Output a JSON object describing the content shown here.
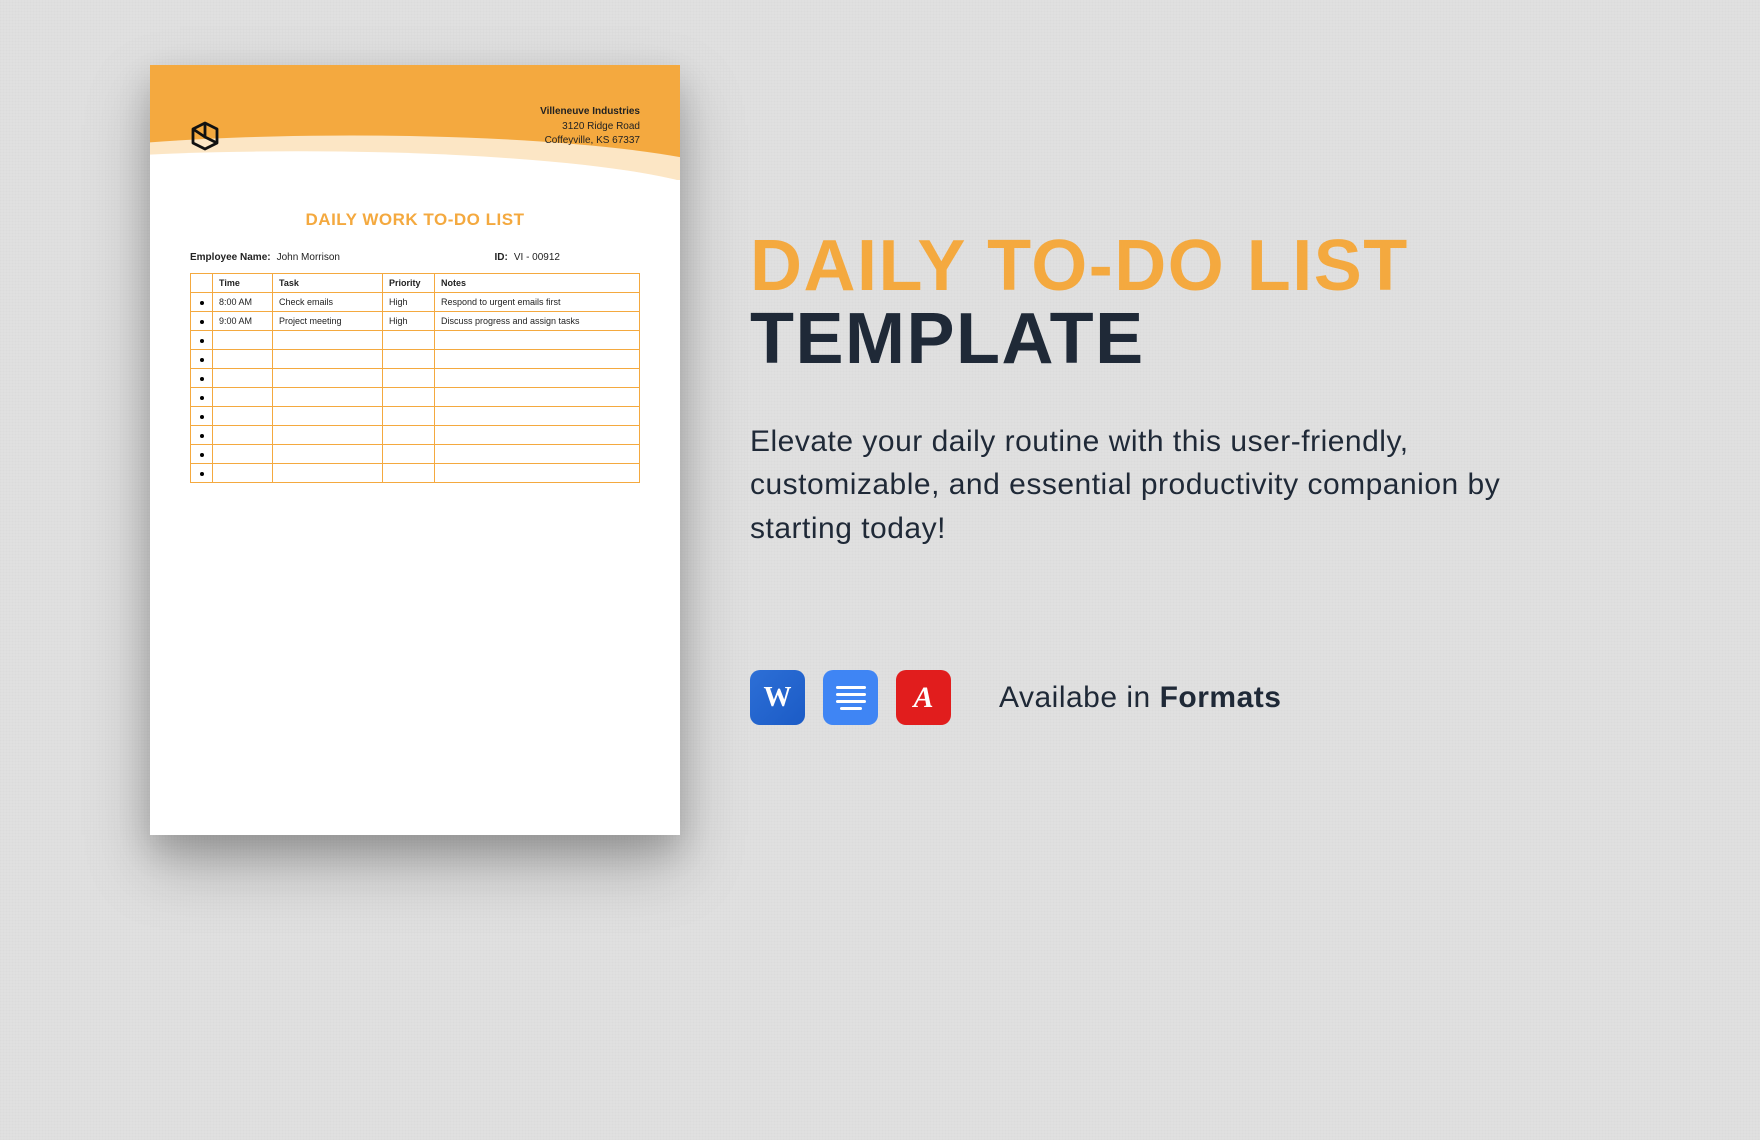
{
  "document": {
    "company": {
      "name": "Villeneuve Industries",
      "addr1": "3120 Ridge Road",
      "addr2": "Coffeyville, KS 67337"
    },
    "title": "DAILY WORK TO-DO LIST",
    "employee": {
      "label": "Employee Name:",
      "value": "John Morrison"
    },
    "id": {
      "label": "ID:",
      "value": "VI - 00912"
    },
    "columns": {
      "time": "Time",
      "task": "Task",
      "priority": "Priority",
      "notes": "Notes"
    },
    "rows": [
      {
        "time": "8:00 AM",
        "task": "Check emails",
        "priority": "High",
        "notes": "Respond to urgent emails first"
      },
      {
        "time": "9:00 AM",
        "task": "Project meeting",
        "priority": "High",
        "notes": "Discuss progress and assign tasks"
      },
      {
        "time": "",
        "task": "",
        "priority": "",
        "notes": ""
      },
      {
        "time": "",
        "task": "",
        "priority": "",
        "notes": ""
      },
      {
        "time": "",
        "task": "",
        "priority": "",
        "notes": ""
      },
      {
        "time": "",
        "task": "",
        "priority": "",
        "notes": ""
      },
      {
        "time": "",
        "task": "",
        "priority": "",
        "notes": ""
      },
      {
        "time": "",
        "task": "",
        "priority": "",
        "notes": ""
      },
      {
        "time": "",
        "task": "",
        "priority": "",
        "notes": ""
      },
      {
        "time": "",
        "task": "",
        "priority": "",
        "notes": ""
      }
    ]
  },
  "pitch": {
    "line1": "DAILY TO-DO LIST",
    "line2": "TEMPLATE",
    "description": "Elevate your daily routine with this user-friendly, customizable, and essential productivity companion by starting today!",
    "availablePrefix": "Availabe in ",
    "availableBold": "Formats",
    "icons": {
      "word": "W",
      "pdf": "ᴬ"
    }
  }
}
